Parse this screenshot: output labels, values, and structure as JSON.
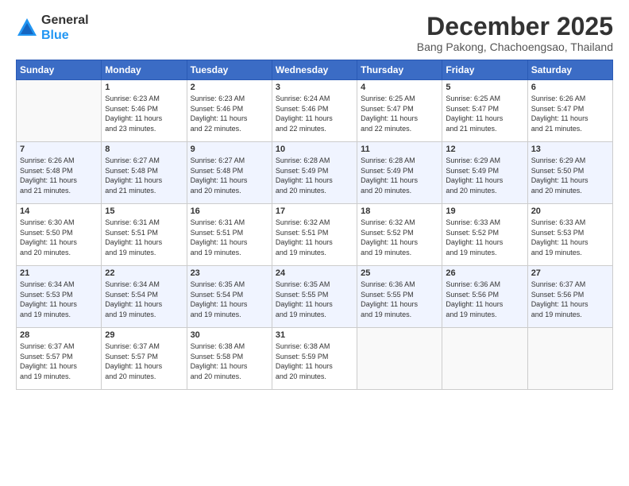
{
  "logo": {
    "line1": "General",
    "line2": "Blue"
  },
  "header": {
    "month": "December 2025",
    "location": "Bang Pakong, Chachoengsao, Thailand"
  },
  "weekdays": [
    "Sunday",
    "Monday",
    "Tuesday",
    "Wednesday",
    "Thursday",
    "Friday",
    "Saturday"
  ],
  "weeks": [
    [
      {
        "day": "",
        "info": ""
      },
      {
        "day": "1",
        "info": "Sunrise: 6:23 AM\nSunset: 5:46 PM\nDaylight: 11 hours\nand 23 minutes."
      },
      {
        "day": "2",
        "info": "Sunrise: 6:23 AM\nSunset: 5:46 PM\nDaylight: 11 hours\nand 22 minutes."
      },
      {
        "day": "3",
        "info": "Sunrise: 6:24 AM\nSunset: 5:46 PM\nDaylight: 11 hours\nand 22 minutes."
      },
      {
        "day": "4",
        "info": "Sunrise: 6:25 AM\nSunset: 5:47 PM\nDaylight: 11 hours\nand 22 minutes."
      },
      {
        "day": "5",
        "info": "Sunrise: 6:25 AM\nSunset: 5:47 PM\nDaylight: 11 hours\nand 21 minutes."
      },
      {
        "day": "6",
        "info": "Sunrise: 6:26 AM\nSunset: 5:47 PM\nDaylight: 11 hours\nand 21 minutes."
      }
    ],
    [
      {
        "day": "7",
        "info": "Sunrise: 6:26 AM\nSunset: 5:48 PM\nDaylight: 11 hours\nand 21 minutes."
      },
      {
        "day": "8",
        "info": "Sunrise: 6:27 AM\nSunset: 5:48 PM\nDaylight: 11 hours\nand 21 minutes."
      },
      {
        "day": "9",
        "info": "Sunrise: 6:27 AM\nSunset: 5:48 PM\nDaylight: 11 hours\nand 20 minutes."
      },
      {
        "day": "10",
        "info": "Sunrise: 6:28 AM\nSunset: 5:49 PM\nDaylight: 11 hours\nand 20 minutes."
      },
      {
        "day": "11",
        "info": "Sunrise: 6:28 AM\nSunset: 5:49 PM\nDaylight: 11 hours\nand 20 minutes."
      },
      {
        "day": "12",
        "info": "Sunrise: 6:29 AM\nSunset: 5:49 PM\nDaylight: 11 hours\nand 20 minutes."
      },
      {
        "day": "13",
        "info": "Sunrise: 6:29 AM\nSunset: 5:50 PM\nDaylight: 11 hours\nand 20 minutes."
      }
    ],
    [
      {
        "day": "14",
        "info": "Sunrise: 6:30 AM\nSunset: 5:50 PM\nDaylight: 11 hours\nand 20 minutes."
      },
      {
        "day": "15",
        "info": "Sunrise: 6:31 AM\nSunset: 5:51 PM\nDaylight: 11 hours\nand 19 minutes."
      },
      {
        "day": "16",
        "info": "Sunrise: 6:31 AM\nSunset: 5:51 PM\nDaylight: 11 hours\nand 19 minutes."
      },
      {
        "day": "17",
        "info": "Sunrise: 6:32 AM\nSunset: 5:51 PM\nDaylight: 11 hours\nand 19 minutes."
      },
      {
        "day": "18",
        "info": "Sunrise: 6:32 AM\nSunset: 5:52 PM\nDaylight: 11 hours\nand 19 minutes."
      },
      {
        "day": "19",
        "info": "Sunrise: 6:33 AM\nSunset: 5:52 PM\nDaylight: 11 hours\nand 19 minutes."
      },
      {
        "day": "20",
        "info": "Sunrise: 6:33 AM\nSunset: 5:53 PM\nDaylight: 11 hours\nand 19 minutes."
      }
    ],
    [
      {
        "day": "21",
        "info": "Sunrise: 6:34 AM\nSunset: 5:53 PM\nDaylight: 11 hours\nand 19 minutes."
      },
      {
        "day": "22",
        "info": "Sunrise: 6:34 AM\nSunset: 5:54 PM\nDaylight: 11 hours\nand 19 minutes."
      },
      {
        "day": "23",
        "info": "Sunrise: 6:35 AM\nSunset: 5:54 PM\nDaylight: 11 hours\nand 19 minutes."
      },
      {
        "day": "24",
        "info": "Sunrise: 6:35 AM\nSunset: 5:55 PM\nDaylight: 11 hours\nand 19 minutes."
      },
      {
        "day": "25",
        "info": "Sunrise: 6:36 AM\nSunset: 5:55 PM\nDaylight: 11 hours\nand 19 minutes."
      },
      {
        "day": "26",
        "info": "Sunrise: 6:36 AM\nSunset: 5:56 PM\nDaylight: 11 hours\nand 19 minutes."
      },
      {
        "day": "27",
        "info": "Sunrise: 6:37 AM\nSunset: 5:56 PM\nDaylight: 11 hours\nand 19 minutes."
      }
    ],
    [
      {
        "day": "28",
        "info": "Sunrise: 6:37 AM\nSunset: 5:57 PM\nDaylight: 11 hours\nand 19 minutes."
      },
      {
        "day": "29",
        "info": "Sunrise: 6:37 AM\nSunset: 5:57 PM\nDaylight: 11 hours\nand 20 minutes."
      },
      {
        "day": "30",
        "info": "Sunrise: 6:38 AM\nSunset: 5:58 PM\nDaylight: 11 hours\nand 20 minutes."
      },
      {
        "day": "31",
        "info": "Sunrise: 6:38 AM\nSunset: 5:59 PM\nDaylight: 11 hours\nand 20 minutes."
      },
      {
        "day": "",
        "info": ""
      },
      {
        "day": "",
        "info": ""
      },
      {
        "day": "",
        "info": ""
      }
    ]
  ]
}
